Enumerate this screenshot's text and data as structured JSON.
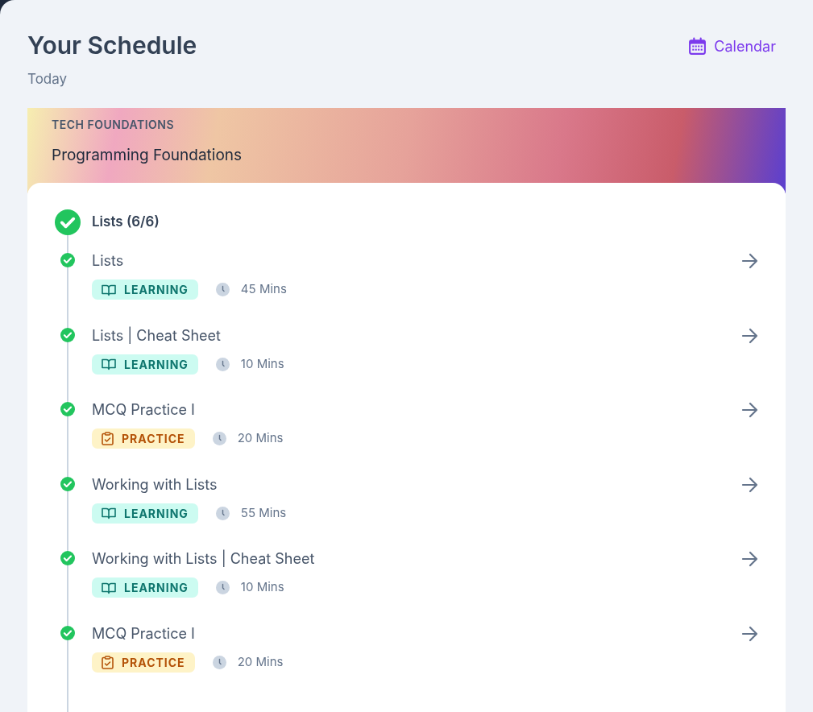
{
  "header": {
    "title": "Your Schedule",
    "subtitle": "Today",
    "calendar_link": "Calendar"
  },
  "course": {
    "category": "TECH FOUNDATIONS",
    "title": "Programming Foundations"
  },
  "module": {
    "title": "Lists (6/6)",
    "completed": true,
    "items": [
      {
        "title": "Lists",
        "kind": "learning",
        "tag": "LEARNING",
        "duration": "45 Mins",
        "completed": true
      },
      {
        "title": "Lists | Cheat Sheet",
        "kind": "learning",
        "tag": "LEARNING",
        "duration": "10 Mins",
        "completed": true
      },
      {
        "title": "MCQ Practice I",
        "kind": "practice",
        "tag": "PRACTICE",
        "duration": "20 Mins",
        "completed": true
      },
      {
        "title": "Working with Lists",
        "kind": "learning",
        "tag": "LEARNING",
        "duration": "55 Mins",
        "completed": true
      },
      {
        "title": "Working with Lists | Cheat Sheet",
        "kind": "learning",
        "tag": "LEARNING",
        "duration": "10 Mins",
        "completed": true
      },
      {
        "title": "MCQ Practice I",
        "kind": "practice",
        "tag": "PRACTICE",
        "duration": "20 Mins",
        "completed": true
      }
    ]
  }
}
